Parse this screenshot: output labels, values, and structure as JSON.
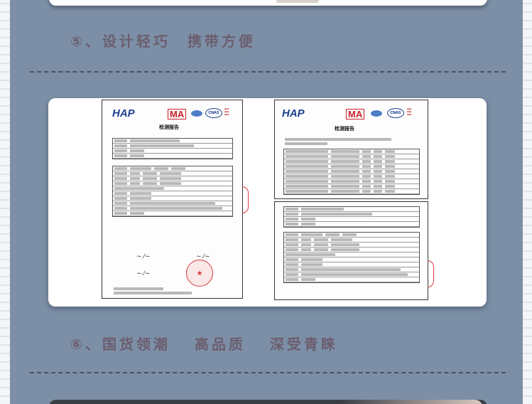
{
  "sections": [
    {
      "number": "⑤",
      "sep": "、",
      "parts": [
        "设计轻巧",
        "携带方便"
      ]
    },
    {
      "number": "⑥",
      "sep": "、",
      "parts": [
        "国货领潮",
        "高品质",
        "深受青睐"
      ]
    }
  ],
  "reports": {
    "title": "检测报告",
    "logos": {
      "hap": "HAP",
      "ma": "MA",
      "cnas": "CNAS"
    }
  }
}
